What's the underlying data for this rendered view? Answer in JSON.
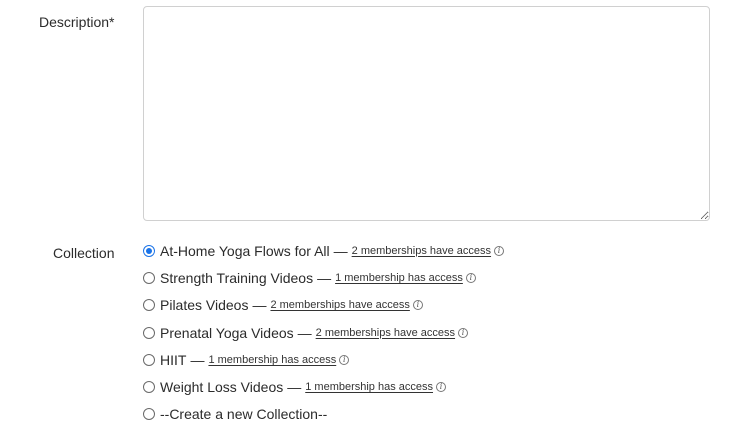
{
  "description": {
    "label": "Description*",
    "value": ""
  },
  "collection": {
    "label": "Collection",
    "selected_index": 0,
    "options": [
      {
        "name": "At-Home Yoga Flows for All",
        "access": "2 memberships have access"
      },
      {
        "name": "Strength Training Videos",
        "access": "1 membership has access"
      },
      {
        "name": "Pilates Videos",
        "access": "2 memberships have access"
      },
      {
        "name": "Prenatal Yoga Videos",
        "access": "2 memberships have access"
      },
      {
        "name": "HIIT",
        "access": "1 membership has access"
      },
      {
        "name": "Weight Loss Videos",
        "access": "1 membership has access"
      },
      {
        "name": "--Create a new Collection--",
        "access": ""
      }
    ],
    "dash": "—",
    "info_icon": "info-icon",
    "accent_color": "#1a73e8"
  }
}
